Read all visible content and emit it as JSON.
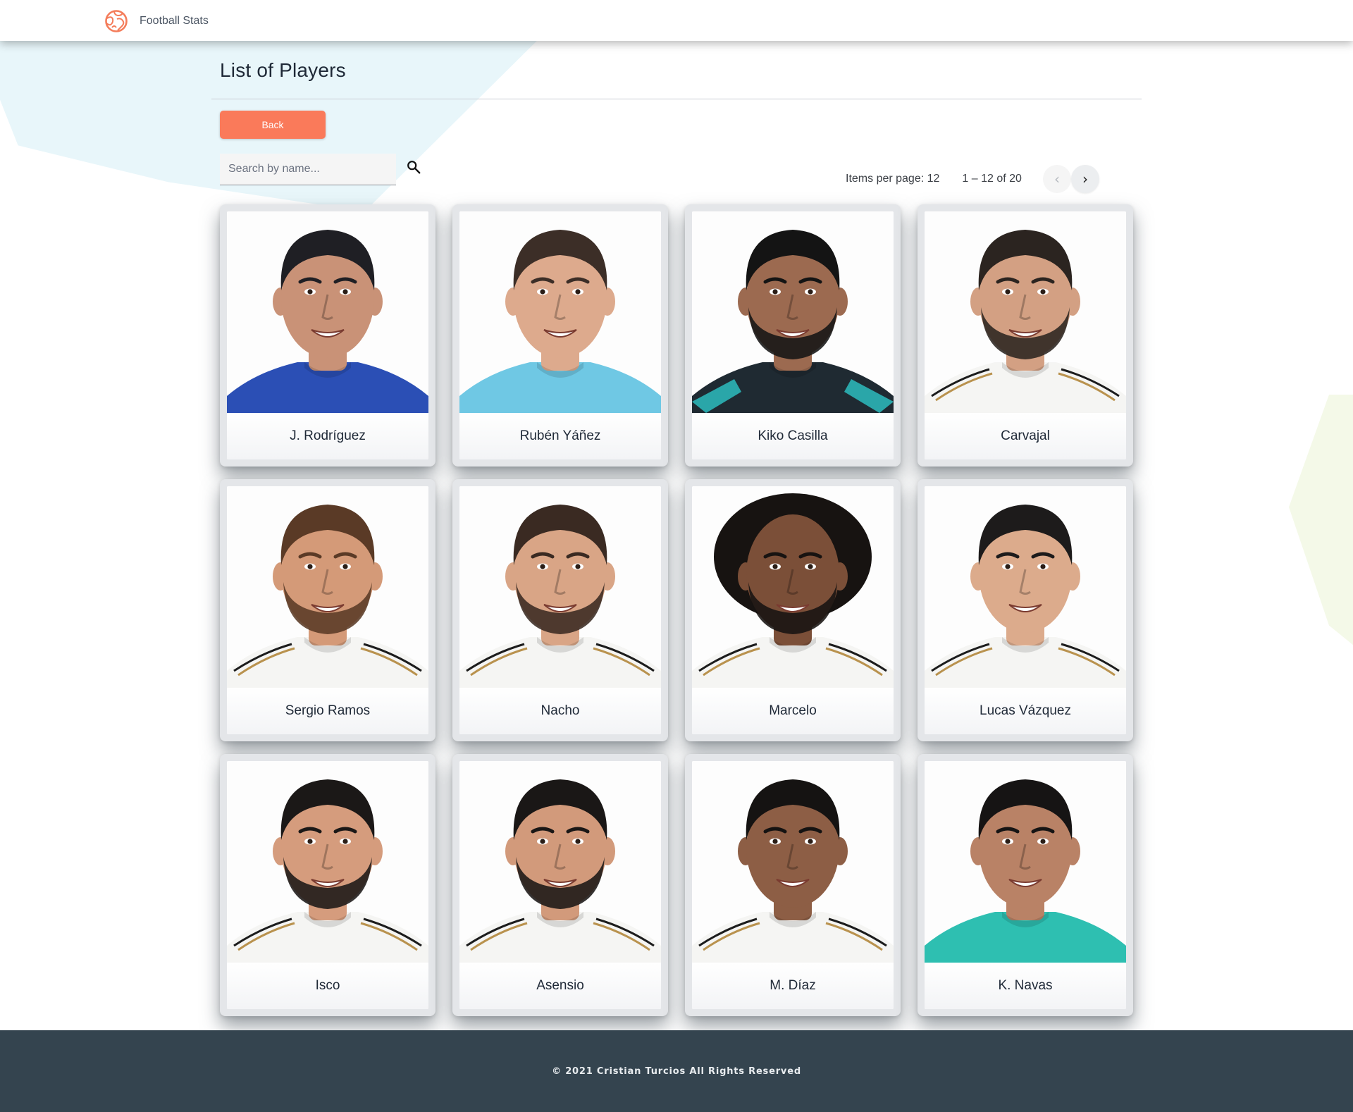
{
  "header": {
    "brand_name": "Football Stats",
    "brand_icon": "globe-icon",
    "brand_color": "#f47c5a"
  },
  "main": {
    "title": "List of Players",
    "back_label": "Back",
    "search": {
      "placeholder": "Search by name...",
      "value": ""
    },
    "paginator": {
      "items_per_page_label": "Items per page: 12",
      "range_label": "1 – 12 of 20",
      "prev_icon": "chevron-left-icon",
      "next_icon": "chevron-right-icon"
    }
  },
  "players": [
    {
      "name": "J. Rodríguez",
      "skin": "#c99277",
      "hair": "#1f1f24",
      "shirt": "#2b4fb5",
      "beard": false,
      "afro": false,
      "trim": "none"
    },
    {
      "name": "Rubén Yáñez",
      "skin": "#ddaa8d",
      "hair": "#3c2e27",
      "shirt": "#6fc8e4",
      "beard": false,
      "afro": false,
      "trim": "none"
    },
    {
      "name": "Kiko Casilla",
      "skin": "#9c6a50",
      "hair": "#141414",
      "shirt": "#1f2a32",
      "beard": true,
      "afro": false,
      "trim": "teal"
    },
    {
      "name": "Carvajal",
      "skin": "#d3a083",
      "hair": "#2b2420",
      "shirt": "#f5f5f3",
      "beard": true,
      "afro": false,
      "trim": "gold"
    },
    {
      "name": "Sergio Ramos",
      "skin": "#d49a78",
      "hair": "#5a3a26",
      "shirt": "#f5f5f3",
      "beard": true,
      "afro": false,
      "trim": "gold"
    },
    {
      "name": "Nacho",
      "skin": "#d9a586",
      "hair": "#3a2a22",
      "shirt": "#f5f5f3",
      "beard": true,
      "afro": false,
      "trim": "gold"
    },
    {
      "name": "Marcelo",
      "skin": "#7b4f38",
      "hair": "#171311",
      "shirt": "#f5f5f3",
      "beard": true,
      "afro": true,
      "trim": "gold"
    },
    {
      "name": "Lucas Vázquez",
      "skin": "#dcab8c",
      "hair": "#1d1b1b",
      "shirt": "#f5f5f3",
      "beard": false,
      "afro": false,
      "trim": "gold"
    },
    {
      "name": "Isco",
      "skin": "#d59c7d",
      "hair": "#1b1817",
      "shirt": "#f5f5f3",
      "beard": true,
      "afro": false,
      "trim": "gold"
    },
    {
      "name": "Asensio",
      "skin": "#d29a7b",
      "hair": "#1a1716",
      "shirt": "#f5f5f3",
      "beard": true,
      "afro": false,
      "trim": "gold"
    },
    {
      "name": "M. Díaz",
      "skin": "#8d5e45",
      "hair": "#151312",
      "shirt": "#f5f5f3",
      "beard": false,
      "afro": false,
      "trim": "gold"
    },
    {
      "name": "K. Navas",
      "skin": "#b98266",
      "hair": "#161414",
      "shirt": "#2ebfb1",
      "beard": false,
      "afro": false,
      "trim": "none"
    }
  ],
  "footer": {
    "text": "© 2021 Cristian Turcios All Rights Reserved"
  }
}
